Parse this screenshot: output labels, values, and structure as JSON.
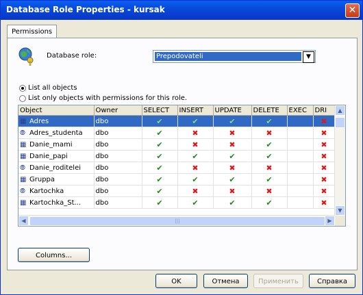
{
  "window": {
    "title": "Database Role Properties - kursak",
    "close_glyph": "✕"
  },
  "tabs": [
    {
      "label": "Permissions"
    }
  ],
  "role": {
    "label": "Database role:",
    "value": "Prepodovateli",
    "arrow": "▼"
  },
  "radios": [
    {
      "label": "List all objects",
      "selected": true
    },
    {
      "label": "List only objects with permissions for this role.",
      "selected": false
    }
  ],
  "grid": {
    "columns": [
      "Object",
      "Owner",
      "SELECT",
      "INSERT",
      "UPDATE",
      "DELETE",
      "EXEC",
      "DRI"
    ],
    "rows": [
      {
        "type": "table",
        "icon": "▦",
        "object": "Adres",
        "owner": "dbo",
        "perms": [
          "✔",
          "✔",
          "✔",
          "✔",
          "",
          "✖"
        ],
        "selected": true
      },
      {
        "type": "view",
        "icon": "⦾",
        "object": "Adres_studenta",
        "owner": "dbo",
        "perms": [
          "✔",
          "✖",
          "✖",
          "✖",
          "",
          "✖"
        ],
        "selected": false
      },
      {
        "type": "table",
        "icon": "▦",
        "object": "Danie_mami",
        "owner": "dbo",
        "perms": [
          "✔",
          "✖",
          "✖",
          "✔",
          "",
          "✖"
        ],
        "selected": false
      },
      {
        "type": "table",
        "icon": "▦",
        "object": "Danie_papi",
        "owner": "dbo",
        "perms": [
          "✔",
          "✔",
          "✔",
          "✔",
          "",
          "✖"
        ],
        "selected": false
      },
      {
        "type": "view",
        "icon": "⦾",
        "object": "Danie_roditelei",
        "owner": "dbo",
        "perms": [
          "✔",
          "✖",
          "✖",
          "✖",
          "",
          "✖"
        ],
        "selected": false
      },
      {
        "type": "table",
        "icon": "▦",
        "object": "Gruppa",
        "owner": "dbo",
        "perms": [
          "✔",
          "✔",
          "✔",
          "✔",
          "",
          "✖"
        ],
        "selected": false
      },
      {
        "type": "view",
        "icon": "⦾",
        "object": "Kartochka",
        "owner": "dbo",
        "perms": [
          "✔",
          "✖",
          "✖",
          "✖",
          "",
          "✖"
        ],
        "selected": false
      },
      {
        "type": "table",
        "icon": "▦",
        "object": "Kartochka_St...",
        "owner": "dbo",
        "perms": [
          "✔",
          "✔",
          "✔",
          "✔",
          "",
          "✖"
        ],
        "selected": false
      }
    ]
  },
  "scroll": {
    "up": "▲",
    "down": "▼",
    "left": "◀",
    "right": "▶",
    "grip": "|||"
  },
  "buttons": {
    "columns": "Columns...",
    "ok": "OK",
    "cancel": "Отмена",
    "apply": "Применить",
    "help": "Справка"
  },
  "colors": {
    "title_bar": "#0848d8",
    "selection": "#316ac5",
    "check": "#1a8a1a",
    "cross": "#e01818"
  }
}
